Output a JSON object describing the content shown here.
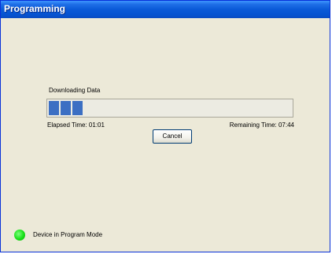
{
  "window": {
    "title": "Programming"
  },
  "download": {
    "label": "Downloading Data",
    "progress_fraction": 0.14,
    "progress_blocks": 3,
    "fill_color": "#3c6fc3",
    "elapsed": "Elapsed Time: 01:01",
    "remaining": "Remaining Time: 07:44"
  },
  "buttons": {
    "cancel_label": "Cancel"
  },
  "status": {
    "led_color": "#18e018",
    "led_icon": "green-status-led-icon",
    "text": "Device in Program Mode"
  }
}
